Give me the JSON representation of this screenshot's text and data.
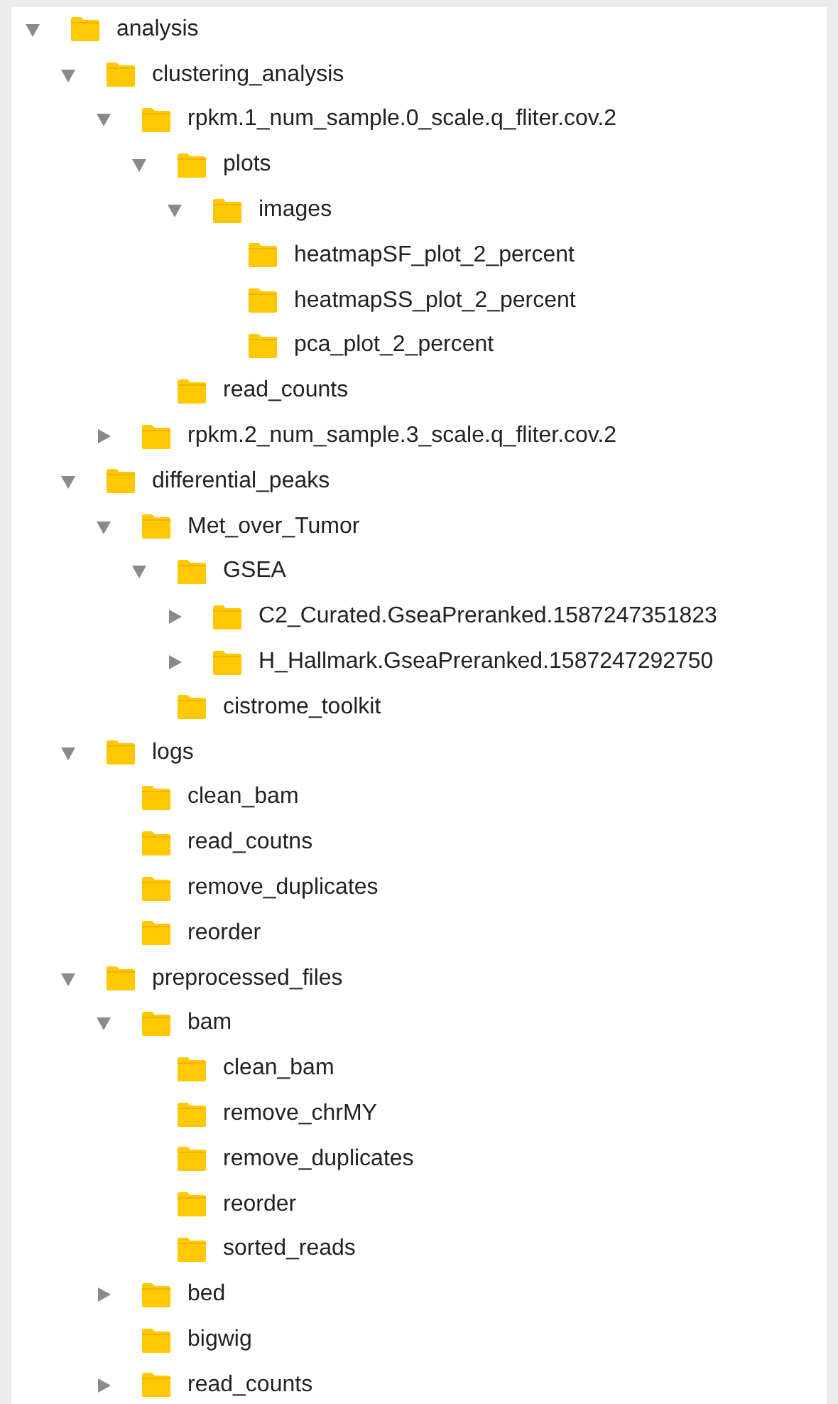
{
  "tree": [
    {
      "name": "analysis",
      "expanded": true,
      "children": [
        {
          "name": "clustering_analysis",
          "expanded": true,
          "children": [
            {
              "name": "rpkm.1_num_sample.0_scale.q_fliter.cov.2",
              "expanded": true,
              "children": [
                {
                  "name": "plots",
                  "expanded": true,
                  "children": [
                    {
                      "name": "images",
                      "expanded": true,
                      "children": [
                        {
                          "name": "heatmapSF_plot_2_percent"
                        },
                        {
                          "name": "heatmapSS_plot_2_percent"
                        },
                        {
                          "name": "pca_plot_2_percent"
                        }
                      ]
                    }
                  ]
                },
                {
                  "name": "read_counts"
                }
              ]
            },
            {
              "name": "rpkm.2_num_sample.3_scale.q_fliter.cov.2",
              "expanded": false
            }
          ]
        },
        {
          "name": "differential_peaks",
          "expanded": true,
          "children": [
            {
              "name": "Met_over_Tumor",
              "expanded": true,
              "children": [
                {
                  "name": "GSEA",
                  "expanded": true,
                  "children": [
                    {
                      "name": "C2_Curated.GseaPreranked.1587247351823",
                      "expanded": false
                    },
                    {
                      "name": "H_Hallmark.GseaPreranked.1587247292750",
                      "expanded": false
                    }
                  ]
                },
                {
                  "name": "cistrome_toolkit"
                }
              ]
            }
          ]
        },
        {
          "name": "logs",
          "expanded": true,
          "children": [
            {
              "name": "clean_bam"
            },
            {
              "name": "read_coutns"
            },
            {
              "name": "remove_duplicates"
            },
            {
              "name": "reorder"
            }
          ]
        },
        {
          "name": "preprocessed_files",
          "expanded": true,
          "children": [
            {
              "name": "bam",
              "expanded": true,
              "children": [
                {
                  "name": "clean_bam"
                },
                {
                  "name": "remove_chrMY"
                },
                {
                  "name": "remove_duplicates"
                },
                {
                  "name": "reorder"
                },
                {
                  "name": "sorted_reads"
                }
              ]
            },
            {
              "name": "bed",
              "expanded": false
            },
            {
              "name": "bigwig"
            },
            {
              "name": "read_counts",
              "expanded": false
            }
          ]
        }
      ]
    }
  ]
}
